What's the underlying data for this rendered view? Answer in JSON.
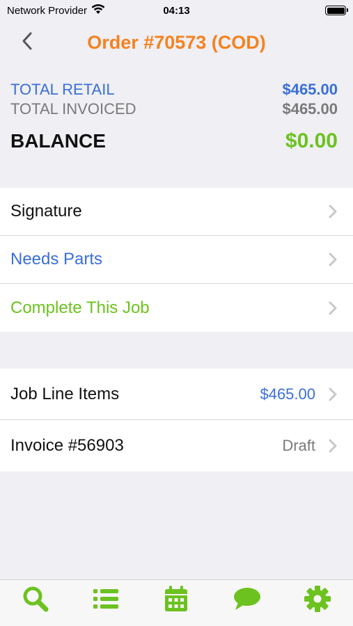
{
  "status_bar": {
    "carrier": "Network Provider",
    "time": "04:13",
    "wifi_icon": "wifi-icon",
    "battery_icon": "battery-icon"
  },
  "nav": {
    "back_icon": "chevron-left-icon",
    "title": "Order #70573 (COD)",
    "title_color": "#f58220"
  },
  "summary": {
    "retail_label": "TOTAL RETAIL",
    "retail_value": "$465.00",
    "invoiced_label": "TOTAL INVOICED",
    "invoiced_value": "$465.00",
    "balance_label": "BALANCE",
    "balance_value": "$0.00",
    "colors": {
      "retail": "#3a6fd8",
      "invoiced": "#7a7a7a",
      "balance": "#6cc21f"
    }
  },
  "actions": {
    "items": [
      {
        "label": "Signature",
        "color": "#111111"
      },
      {
        "label": "Needs Parts",
        "color": "#3a6fd8"
      },
      {
        "label": "Complete This Job",
        "color": "#6cc21f"
      }
    ]
  },
  "details": {
    "items": [
      {
        "label": "Job Line Items",
        "value": "$465.00",
        "value_color": "#3a6fd8"
      },
      {
        "label": "Invoice #56903",
        "value": "Draft",
        "value_color": "#7a7a7a"
      }
    ]
  },
  "tab_bar": {
    "accent": "#6cc21f",
    "tabs": [
      {
        "icon": "search-icon"
      },
      {
        "icon": "list-icon"
      },
      {
        "icon": "calendar-icon"
      },
      {
        "icon": "chat-bubble-icon"
      },
      {
        "icon": "gear-icon"
      }
    ]
  }
}
